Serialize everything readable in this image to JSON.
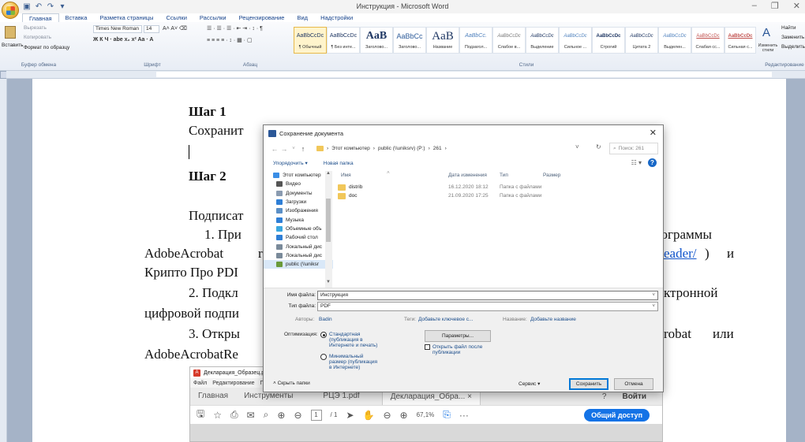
{
  "window": {
    "title": "Инструкция - Microsoft Word"
  },
  "ribbon": {
    "tabs": [
      "Главная",
      "Вставка",
      "Разметка страницы",
      "Ссылки",
      "Рассылки",
      "Рецензирование",
      "Вид",
      "Надстройки"
    ],
    "clipboard": {
      "paste": "Вставить",
      "cut": "Вырезать",
      "copy": "Копировать",
      "format_painter": "Формат по образцу",
      "group": "Буфер обмена"
    },
    "font": {
      "name": "Times New Roman",
      "size": "14",
      "group": "Шрифт"
    },
    "paragraph_group": "Абзац",
    "styles": [
      {
        "sample": "AaBbCcDc",
        "name": "¶ Обычный"
      },
      {
        "sample": "AaBbCcDc",
        "name": "¶ Без инте..."
      },
      {
        "sample": "AaB",
        "name": "Заголово..."
      },
      {
        "sample": "AaBbCc",
        "name": "Заголово..."
      },
      {
        "sample": "AaB",
        "name": "Название"
      },
      {
        "sample": "AaBbCc.",
        "name": "Подзагол..."
      },
      {
        "sample": "AaBbCcDc",
        "name": "Слабое в..."
      },
      {
        "sample": "AaBbCcDc",
        "name": "Выделение"
      },
      {
        "sample": "AaBbCcDc",
        "name": "Сильное ..."
      },
      {
        "sample": "AaBbCcDc",
        "name": "Строгий"
      },
      {
        "sample": "AaBbCcDc",
        "name": "Цитата 2"
      },
      {
        "sample": "AaBbCcDc",
        "name": "Выделен..."
      },
      {
        "sample": "AaBbCcDc",
        "name": "Слабая сс..."
      },
      {
        "sample": "AaBbCcDc",
        "name": "Сильная с..."
      }
    ],
    "styles_group": "Стили",
    "change_styles": "Изменить стили",
    "editing": {
      "find": "Найти",
      "replace": "Заменить",
      "select": "Выделить",
      "group": "Редактирование"
    }
  },
  "document": {
    "step1_heading": "Шаг 1",
    "step1_text": "Сохранит",
    "step2_heading": "Шаг 2",
    "sign_text": "Подписат",
    "item1_a": "1.  При",
    "item1_b": "рограммы",
    "line_adobe": "AdobeAcrobat",
    "line_adobe_mid": "r",
    "link_tail": "eader/",
    "link_close": ")",
    "conj_and": "и",
    "line_crypto": "Крипто Про PDI",
    "item2_a": "2.  Подкл",
    "item2_b": "ктронной",
    "line_sig": "цифровой подпи",
    "item3_a": "3.  Откры",
    "item3_b": "robat",
    "item3_or": "или",
    "line_reader": "AdobeAcrobatRe"
  },
  "acrobat": {
    "title": "Декларация_Образец.pdf",
    "menu": [
      "Файл",
      "Редактирование",
      "П"
    ],
    "tabs": [
      "Главная",
      "Инструменты",
      "РЦЭ 1.pdf",
      "Декларация_Обра...  ×"
    ],
    "sign_in": "Войти",
    "page_current": "1",
    "page_total": "/ 1",
    "zoom": "67,1%",
    "share": "Общий доступ"
  },
  "dialog": {
    "title": "Сохранение документа",
    "breadcrumb": [
      "Этот компьютер",
      "public (\\\\uniksrv) (P:)",
      "261"
    ],
    "search_placeholder": "Поиск: 261",
    "organize": "Упорядочить ▾",
    "new_folder": "Новая папка",
    "nav_items": [
      {
        "label": "Этот компьютер",
        "icon": "computer-icon",
        "color": "#3a8ee6"
      },
      {
        "label": "Видео",
        "icon": "video-icon",
        "color": "#555555"
      },
      {
        "label": "Документы",
        "icon": "documents-icon",
        "color": "#8a9bb0"
      },
      {
        "label": "Загрузки",
        "icon": "downloads-icon",
        "color": "#2f7fd6"
      },
      {
        "label": "Изображения",
        "icon": "pictures-icon",
        "color": "#5a8fc6"
      },
      {
        "label": "Музыка",
        "icon": "music-icon",
        "color": "#2f7fd6"
      },
      {
        "label": "Объемные объ",
        "icon": "3d-objects-icon",
        "color": "#3aa7e0"
      },
      {
        "label": "Рабочий стол",
        "icon": "desktop-icon",
        "color": "#2f7fd6"
      },
      {
        "label": "Локальный дис",
        "icon": "drive-icon",
        "color": "#7a8a9a"
      },
      {
        "label": "Локальный дис",
        "icon": "drive-icon",
        "color": "#7a8a9a"
      },
      {
        "label": "public (\\\\uniksr",
        "icon": "network-drive-icon",
        "color": "#6a9a3a"
      }
    ],
    "columns": [
      "Имя",
      "Дата изменения",
      "Тип",
      "Размер"
    ],
    "files": [
      {
        "name": "distrib",
        "date": "16.12.2020 18:12",
        "type": "Папка с файлами"
      },
      {
        "name": "doc",
        "date": "21.09.2020 17:25",
        "type": "Папка с файлами"
      }
    ],
    "filename_label": "Имя файла:",
    "filename_value": "Инструкция",
    "filetype_label": "Тип файла:",
    "filetype_value": "PDF",
    "authors_label": "Авторы:",
    "authors_value": "Badin",
    "tags_label": "Теги:",
    "tags_value": "Добавьте ключевое с...",
    "title_label": "Название:",
    "title_value": "Добавьте название",
    "optimize_label": "Оптимизация:",
    "opt_standard": [
      "Стандартная",
      "(публикация в",
      "Интернете и печать)"
    ],
    "opt_minimal": [
      "Минимальный",
      "размер (публикация",
      "в Интернете)"
    ],
    "options_button": "Параметры...",
    "open_after": [
      "Открыть файл после",
      "публикации"
    ],
    "hide_folders": "Скрыть папки",
    "tools": "Сервис",
    "save": "Сохранить",
    "cancel": "Отмена"
  }
}
